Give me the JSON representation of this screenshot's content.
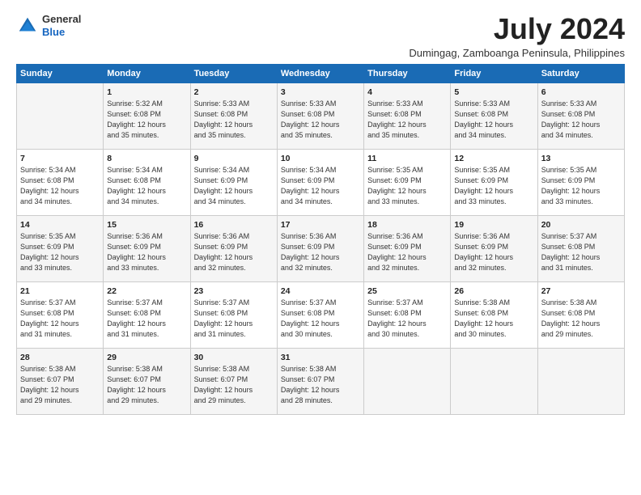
{
  "logo": {
    "general": "General",
    "blue": "Blue"
  },
  "title": "July 2024",
  "location": "Dumingag, Zamboanga Peninsula, Philippines",
  "days_header": [
    "Sunday",
    "Monday",
    "Tuesday",
    "Wednesday",
    "Thursday",
    "Friday",
    "Saturday"
  ],
  "weeks": [
    [
      {
        "day": "",
        "info": ""
      },
      {
        "day": "1",
        "info": "Sunrise: 5:32 AM\nSunset: 6:08 PM\nDaylight: 12 hours\nand 35 minutes."
      },
      {
        "day": "2",
        "info": "Sunrise: 5:33 AM\nSunset: 6:08 PM\nDaylight: 12 hours\nand 35 minutes."
      },
      {
        "day": "3",
        "info": "Sunrise: 5:33 AM\nSunset: 6:08 PM\nDaylight: 12 hours\nand 35 minutes."
      },
      {
        "day": "4",
        "info": "Sunrise: 5:33 AM\nSunset: 6:08 PM\nDaylight: 12 hours\nand 35 minutes."
      },
      {
        "day": "5",
        "info": "Sunrise: 5:33 AM\nSunset: 6:08 PM\nDaylight: 12 hours\nand 34 minutes."
      },
      {
        "day": "6",
        "info": "Sunrise: 5:33 AM\nSunset: 6:08 PM\nDaylight: 12 hours\nand 34 minutes."
      }
    ],
    [
      {
        "day": "7",
        "info": "Sunrise: 5:34 AM\nSunset: 6:08 PM\nDaylight: 12 hours\nand 34 minutes."
      },
      {
        "day": "8",
        "info": "Sunrise: 5:34 AM\nSunset: 6:08 PM\nDaylight: 12 hours\nand 34 minutes."
      },
      {
        "day": "9",
        "info": "Sunrise: 5:34 AM\nSunset: 6:09 PM\nDaylight: 12 hours\nand 34 minutes."
      },
      {
        "day": "10",
        "info": "Sunrise: 5:34 AM\nSunset: 6:09 PM\nDaylight: 12 hours\nand 34 minutes."
      },
      {
        "day": "11",
        "info": "Sunrise: 5:35 AM\nSunset: 6:09 PM\nDaylight: 12 hours\nand 33 minutes."
      },
      {
        "day": "12",
        "info": "Sunrise: 5:35 AM\nSunset: 6:09 PM\nDaylight: 12 hours\nand 33 minutes."
      },
      {
        "day": "13",
        "info": "Sunrise: 5:35 AM\nSunset: 6:09 PM\nDaylight: 12 hours\nand 33 minutes."
      }
    ],
    [
      {
        "day": "14",
        "info": "Sunrise: 5:35 AM\nSunset: 6:09 PM\nDaylight: 12 hours\nand 33 minutes."
      },
      {
        "day": "15",
        "info": "Sunrise: 5:36 AM\nSunset: 6:09 PM\nDaylight: 12 hours\nand 33 minutes."
      },
      {
        "day": "16",
        "info": "Sunrise: 5:36 AM\nSunset: 6:09 PM\nDaylight: 12 hours\nand 32 minutes."
      },
      {
        "day": "17",
        "info": "Sunrise: 5:36 AM\nSunset: 6:09 PM\nDaylight: 12 hours\nand 32 minutes."
      },
      {
        "day": "18",
        "info": "Sunrise: 5:36 AM\nSunset: 6:09 PM\nDaylight: 12 hours\nand 32 minutes."
      },
      {
        "day": "19",
        "info": "Sunrise: 5:36 AM\nSunset: 6:09 PM\nDaylight: 12 hours\nand 32 minutes."
      },
      {
        "day": "20",
        "info": "Sunrise: 5:37 AM\nSunset: 6:08 PM\nDaylight: 12 hours\nand 31 minutes."
      }
    ],
    [
      {
        "day": "21",
        "info": "Sunrise: 5:37 AM\nSunset: 6:08 PM\nDaylight: 12 hours\nand 31 minutes."
      },
      {
        "day": "22",
        "info": "Sunrise: 5:37 AM\nSunset: 6:08 PM\nDaylight: 12 hours\nand 31 minutes."
      },
      {
        "day": "23",
        "info": "Sunrise: 5:37 AM\nSunset: 6:08 PM\nDaylight: 12 hours\nand 31 minutes."
      },
      {
        "day": "24",
        "info": "Sunrise: 5:37 AM\nSunset: 6:08 PM\nDaylight: 12 hours\nand 30 minutes."
      },
      {
        "day": "25",
        "info": "Sunrise: 5:37 AM\nSunset: 6:08 PM\nDaylight: 12 hours\nand 30 minutes."
      },
      {
        "day": "26",
        "info": "Sunrise: 5:38 AM\nSunset: 6:08 PM\nDaylight: 12 hours\nand 30 minutes."
      },
      {
        "day": "27",
        "info": "Sunrise: 5:38 AM\nSunset: 6:08 PM\nDaylight: 12 hours\nand 29 minutes."
      }
    ],
    [
      {
        "day": "28",
        "info": "Sunrise: 5:38 AM\nSunset: 6:07 PM\nDaylight: 12 hours\nand 29 minutes."
      },
      {
        "day": "29",
        "info": "Sunrise: 5:38 AM\nSunset: 6:07 PM\nDaylight: 12 hours\nand 29 minutes."
      },
      {
        "day": "30",
        "info": "Sunrise: 5:38 AM\nSunset: 6:07 PM\nDaylight: 12 hours\nand 29 minutes."
      },
      {
        "day": "31",
        "info": "Sunrise: 5:38 AM\nSunset: 6:07 PM\nDaylight: 12 hours\nand 28 minutes."
      },
      {
        "day": "",
        "info": ""
      },
      {
        "day": "",
        "info": ""
      },
      {
        "day": "",
        "info": ""
      }
    ]
  ]
}
